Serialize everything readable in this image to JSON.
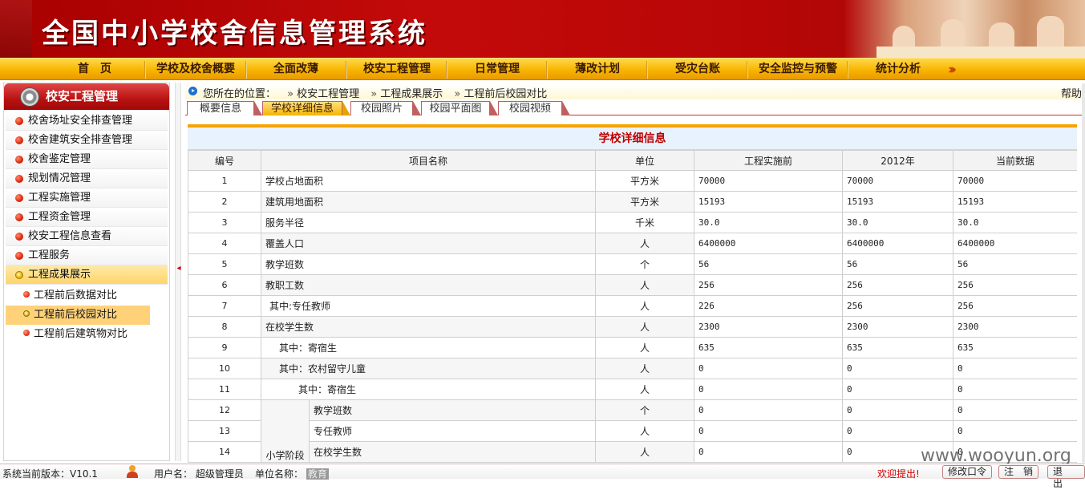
{
  "header": {
    "title": "全国中小学校舍信息管理系统"
  },
  "nav": {
    "items": [
      "首　页",
      "学校及校舍概要",
      "全面改薄",
      "校安工程管理",
      "日常管理",
      "薄改计划",
      "受灾台账",
      "安全监控与预警",
      "统计分析"
    ]
  },
  "sidebar": {
    "title": "校安工程管理",
    "items": [
      {
        "label": "校舍场址安全排查管理"
      },
      {
        "label": "校舍建筑安全排查管理"
      },
      {
        "label": "校舍鉴定管理"
      },
      {
        "label": "规划情况管理"
      },
      {
        "label": "工程实施管理"
      },
      {
        "label": "工程资金管理"
      },
      {
        "label": "校安工程信息查看"
      },
      {
        "label": "工程服务"
      },
      {
        "label": "工程成果展示"
      }
    ],
    "subitems": [
      {
        "label": "工程前后数据对比"
      },
      {
        "label": "工程前后校园对比"
      },
      {
        "label": "工程前后建筑物对比"
      }
    ]
  },
  "breadcrumb": {
    "prefix": "您所在的位置：",
    "levels": [
      "校安工程管理",
      "工程成果展示",
      "工程前后校园对比"
    ],
    "help": "帮助"
  },
  "tabs": [
    "概要信息",
    "学校详细信息",
    "校园照片",
    "校园平面图",
    "校园视频"
  ],
  "detail": {
    "title": "学校详细信息",
    "columns": [
      "编号",
      "项目名称",
      "单位",
      "工程实施前",
      "2012年",
      "当前数据"
    ],
    "group_label": "小学阶段",
    "rows": [
      {
        "no": "1",
        "name": "学校占地面积",
        "unit": "平方米",
        "before": "70000",
        "y2012": "70000",
        "current": "70000"
      },
      {
        "no": "2",
        "name": "建筑用地面积",
        "unit": "平方米",
        "before": "15193",
        "y2012": "15193",
        "current": "15193"
      },
      {
        "no": "3",
        "name": "服务半径",
        "unit": "千米",
        "before": "30.0",
        "y2012": "30.0",
        "current": "30.0"
      },
      {
        "no": "4",
        "name": "覆盖人口",
        "unit": "人",
        "before": "6400000",
        "y2012": "6400000",
        "current": "6400000"
      },
      {
        "no": "5",
        "name": "教学班数",
        "unit": "个",
        "before": "56",
        "y2012": "56",
        "current": "56"
      },
      {
        "no": "6",
        "name": "教职工数",
        "unit": "人",
        "before": "256",
        "y2012": "256",
        "current": "256"
      },
      {
        "no": "7",
        "name": "其中:专任教师",
        "unit": "人",
        "before": "226",
        "y2012": "256",
        "current": "256"
      },
      {
        "no": "8",
        "name": "在校学生数",
        "unit": "人",
        "before": "2300",
        "y2012": "2300",
        "current": "2300"
      },
      {
        "no": "9",
        "name": "其中：寄宿生",
        "unit": "人",
        "before": "635",
        "y2012": "635",
        "current": "635"
      },
      {
        "no": "10",
        "name": "其中：农村留守儿童",
        "unit": "人",
        "before": "0",
        "y2012": "0",
        "current": "0"
      },
      {
        "no": "11",
        "name": "其中：寄宿生",
        "unit": "人",
        "before": "0",
        "y2012": "0",
        "current": "0"
      },
      {
        "no": "12",
        "name": "教学班数",
        "unit": "个",
        "before": "0",
        "y2012": "0",
        "current": "0"
      },
      {
        "no": "13",
        "name": "专任教师",
        "unit": "人",
        "before": "0",
        "y2012": "0",
        "current": "0"
      },
      {
        "no": "14",
        "name": "在校学生数",
        "unit": "人",
        "before": "0",
        "y2012": "0",
        "current": "0"
      }
    ]
  },
  "footer": {
    "version": "系统当前版本：V10.1",
    "user_label": "用户名：",
    "user": "超级管理员",
    "unit_label": "单位名称：",
    "unit": "教育",
    "welcome": "欢迎提出!",
    "buttons": [
      "修改口令",
      "注　销",
      "退　出"
    ]
  },
  "watermark": "www.wooyun.org"
}
